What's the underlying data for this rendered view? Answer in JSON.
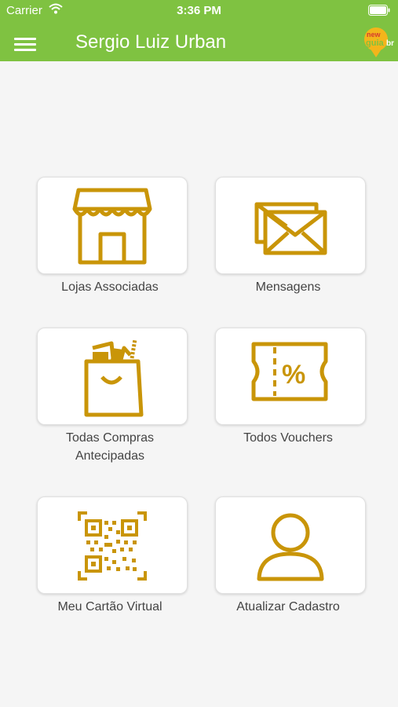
{
  "status_bar": {
    "carrier": "Carrier",
    "time": "3:36 PM"
  },
  "header": {
    "title": "Sergio Luiz Urban",
    "logo_text": "new guia br"
  },
  "menu": [
    {
      "label": "Lojas Associadas",
      "icon": "store-icon"
    },
    {
      "label": "Mensagens",
      "icon": "envelopes-icon"
    },
    {
      "label": "Todas Compras\nAntecipadas",
      "icon": "shopping-bag-icon"
    },
    {
      "label": "Todos Vouchers",
      "icon": "voucher-ticket-icon"
    },
    {
      "label": "Meu Cartão Virtual",
      "icon": "qr-code-icon"
    },
    {
      "label": "Atualizar Cadastro",
      "icon": "user-icon"
    }
  ],
  "colors": {
    "header": "#7fc241",
    "icon": "#c99508",
    "background": "#f5f5f5"
  }
}
